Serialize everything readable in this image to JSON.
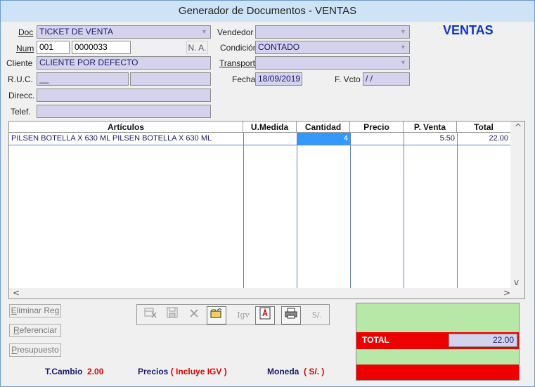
{
  "window": {
    "title": "Generador de Documentos - VENTAS"
  },
  "header": {
    "title": "VENTAS"
  },
  "form": {
    "doc_label": "Doc",
    "doc_value": "TICKET DE VENTA",
    "num_label": "Num",
    "num_series": "001",
    "num_number": "0000033",
    "na_label": "N. A.",
    "cliente_label": "Cliente",
    "cliente_value": "CLIENTE POR DEFECTO",
    "ruc_label": "R.U.C.",
    "ruc_value": "__",
    "ruc_extra": "",
    "direcc_label": "Direcc.",
    "direcc_value": "",
    "telef_label": "Telef.",
    "telef_value": "",
    "vendedor_label": "Vendedor",
    "vendedor_value": "",
    "condicion_label": "Condición",
    "condicion_value": "CONTADO",
    "transport_label": "Transport.",
    "transport_value": "",
    "fecha_label": "Fecha",
    "fecha_value": "18/09/2019",
    "fvcto_label": "F. Vcto",
    "fvcto_value": " / /"
  },
  "grid": {
    "columns": [
      "Artículos",
      "U.Medida",
      "Cantidad",
      "Precio",
      "P. Venta",
      "Total"
    ],
    "rows": [
      {
        "articulo": "PILSEN BOTELLA X 630 ML PILSEN BOTELLA X 630 ML",
        "umedida": "",
        "cantidad": "4",
        "precio": "",
        "pventa": "5.50",
        "total": "22.00"
      }
    ]
  },
  "side_buttons": {
    "eliminar_pre": "E",
    "eliminar_post": "liminar Reg",
    "referenciar_pre": "R",
    "referenciar_post": "eferenciar",
    "presupuesto_pre": "P",
    "presupuesto_post": "resupuesto"
  },
  "toolbar": {
    "icons": [
      "grid-delete-icon",
      "save-icon",
      "cancel-icon",
      "open-folder-icon",
      "igv-icon",
      "pdf-icon",
      "print-icon",
      "currency-icon"
    ],
    "igv_label": "Igv",
    "currency_label": "S/."
  },
  "totals": {
    "total_label": "TOTAL",
    "total_value": "22.00"
  },
  "footer": {
    "tcambio_label": "T.Cambio",
    "tcambio_value": "2.00",
    "precios_label": "Precios",
    "precios_value": "( Incluye IGV )",
    "moneda_label": "Moneda",
    "moneda_value": "( S/. )"
  },
  "colors": {
    "accent_blue": "#1133cc",
    "total_red": "#ee0000",
    "totals_green": "#b8e8a8",
    "field_bg": "#d4d2ec"
  }
}
